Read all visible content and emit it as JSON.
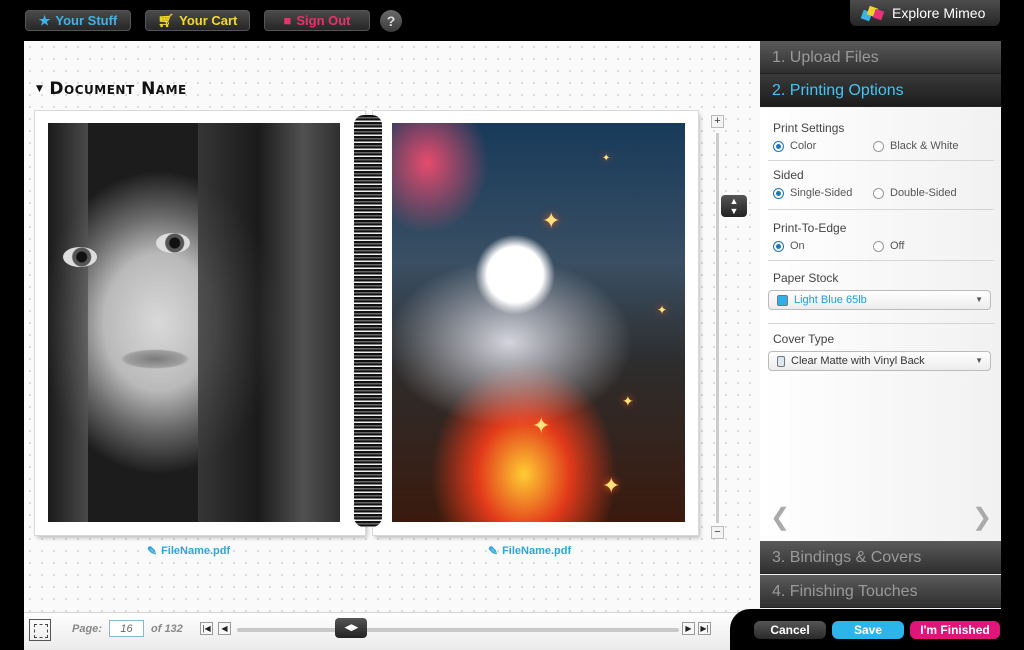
{
  "topbar": {
    "your_stuff": "Your Stuff",
    "your_cart": "Your Cart",
    "sign_out": "Sign Out",
    "help": "?",
    "explore": "Explore Mimeo",
    "colors": {
      "your_stuff": "#3fb3e8",
      "your_cart": "#f4d92b",
      "sign_out": "#e8336a"
    }
  },
  "document": {
    "title": "Document Name",
    "left_file": "FileName.pdf",
    "right_file": "FileName.pdf"
  },
  "zoom": {
    "plus": "+",
    "minus": "−"
  },
  "pager": {
    "page_label": "Page:",
    "current_page": "16",
    "total": "of 132",
    "progress": 0.24
  },
  "steps": [
    {
      "label": "1. Upload Files"
    },
    {
      "label": "2. Printing Options"
    },
    {
      "label": "3. Bindings & Covers"
    },
    {
      "label": "4. Finishing Touches"
    }
  ],
  "options": {
    "print_settings": {
      "title": "Print Settings",
      "opt1": "Color",
      "opt2": "Black & White",
      "selected": "Color"
    },
    "sided": {
      "title": "Sided",
      "opt1": "Single-Sided",
      "opt2": "Double-Sided",
      "selected": "Single-Sided"
    },
    "print_to_edge": {
      "title": "Print-To-Edge",
      "opt1": "On",
      "opt2": "Off",
      "selected": "On"
    },
    "paper_stock": {
      "title": "Paper Stock",
      "value": "Light Blue 65lb",
      "color": "#1f9ee0"
    },
    "cover_type": {
      "title": "Cover Type",
      "value": "Clear Matte with Vinyl Back"
    }
  },
  "actions": {
    "cancel": "Cancel",
    "save": "Save",
    "finished": "I'm Finished",
    "colors": {
      "save": "#2bb5ea",
      "finished": "#e0157a"
    }
  }
}
